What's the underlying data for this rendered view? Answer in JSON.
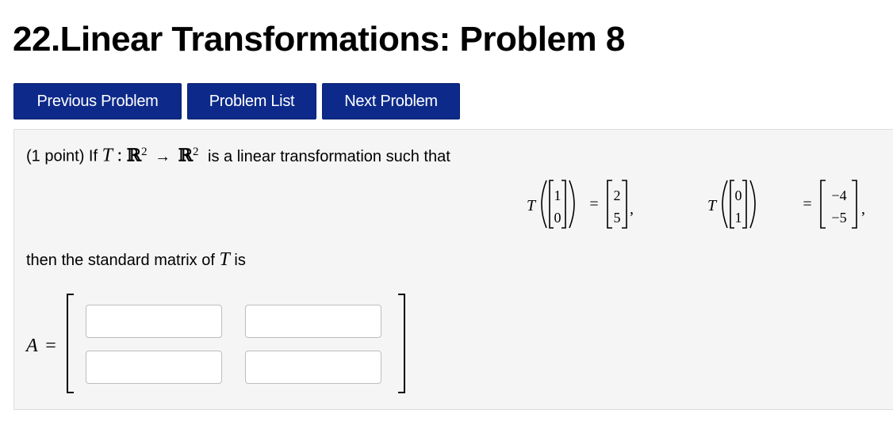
{
  "page": {
    "title": "22.Linear Transformations: Problem 8"
  },
  "nav": {
    "previous_label": "Previous Problem",
    "list_label": "Problem List",
    "next_label": "Next Problem"
  },
  "problem": {
    "points": "(1 point) If",
    "map_symbol": "T",
    "colon": ":",
    "domain": "ℝ",
    "domain_exp": "2",
    "arrow": "→",
    "codomain": "ℝ",
    "codomain_exp": "2",
    "intro_rest": "is a linear transformation such that",
    "eq1": {
      "T": "T",
      "input": [
        "1",
        "0"
      ],
      "equals": "=",
      "output": [
        "2",
        "5"
      ],
      "sep": ","
    },
    "eq2": {
      "T": "T",
      "input": [
        "0",
        "1"
      ],
      "equals": "=",
      "output": [
        "−4",
        "−5"
      ],
      "sep": ","
    },
    "then_text": "then the standard matrix of",
    "then_symbol": "T",
    "then_end": "is",
    "matrix_label": "A",
    "matrix_equals": "="
  },
  "answer_inputs": [
    {
      "value": "",
      "placeholder": ""
    },
    {
      "value": "",
      "placeholder": ""
    },
    {
      "value": "",
      "placeholder": ""
    },
    {
      "value": "",
      "placeholder": ""
    }
  ]
}
